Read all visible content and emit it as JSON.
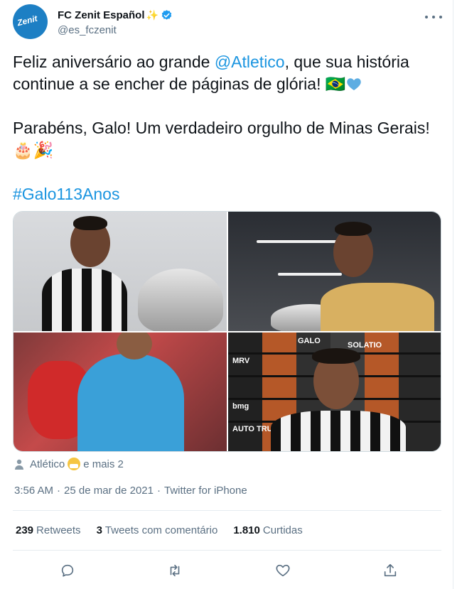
{
  "account": {
    "display_name": "FC Zenit Español",
    "badge_emoji": "✨",
    "handle": "@es_fczenit",
    "avatar_text": "Zenit"
  },
  "tweet": {
    "line1_prefix": "Feliz aniversário ao grande ",
    "mention": "@Atletico",
    "line1_suffix": ", que sua história continue a se encher de páginas de glória! ",
    "flag_emoji": "🇧🇷",
    "paragraph2": "Parabéns, Galo! Um verdadeiro orgulho de Minas Gerais! ",
    "emojis2": "🎂🎉",
    "hashtag": "#Galo113Anos"
  },
  "media": {
    "board_labels": [
      "MRV",
      "bmg",
      "AUTO TRUCK",
      "SOLATIO",
      "GALO"
    ],
    "photo4_shirt_text": "MRV"
  },
  "liked_by": {
    "name": "Atlético",
    "suffix": "e mais 2"
  },
  "meta": {
    "time": "3:56 AM",
    "date": "25 de mar de 2021",
    "source": "Twitter for iPhone",
    "separator": "·"
  },
  "stats": {
    "retweets_count": "239",
    "retweets_label": "Retweets",
    "quotes_count": "3",
    "quotes_label": "Tweets com comentário",
    "likes_count": "1.810",
    "likes_label": "Curtidas"
  },
  "icons": {
    "reply": "reply-icon",
    "retweet": "retweet-icon",
    "like": "heart-icon",
    "share": "share-icon"
  },
  "colors": {
    "link": "#1b95e0",
    "verified": "#1d9bf0",
    "secondary_text": "#5b7083"
  }
}
